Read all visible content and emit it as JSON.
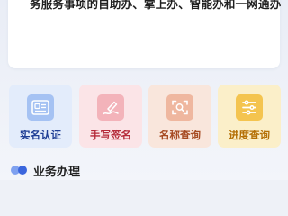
{
  "intro": {
    "text": "务服务事项的自助办、掌上办、智能办和一网通办"
  },
  "services": [
    {
      "label": "实名认证",
      "icon": "id-card-icon",
      "color": "#1f3e95"
    },
    {
      "label": "手写签名",
      "icon": "signature-pen-icon",
      "color": "#b52a3a"
    },
    {
      "label": "名称查询",
      "icon": "name-search-icon",
      "color": "#a64a22"
    },
    {
      "label": "进度查询",
      "icon": "progress-list-icon",
      "color": "#b46f05"
    }
  ],
  "section": {
    "title": "业务办理"
  }
}
